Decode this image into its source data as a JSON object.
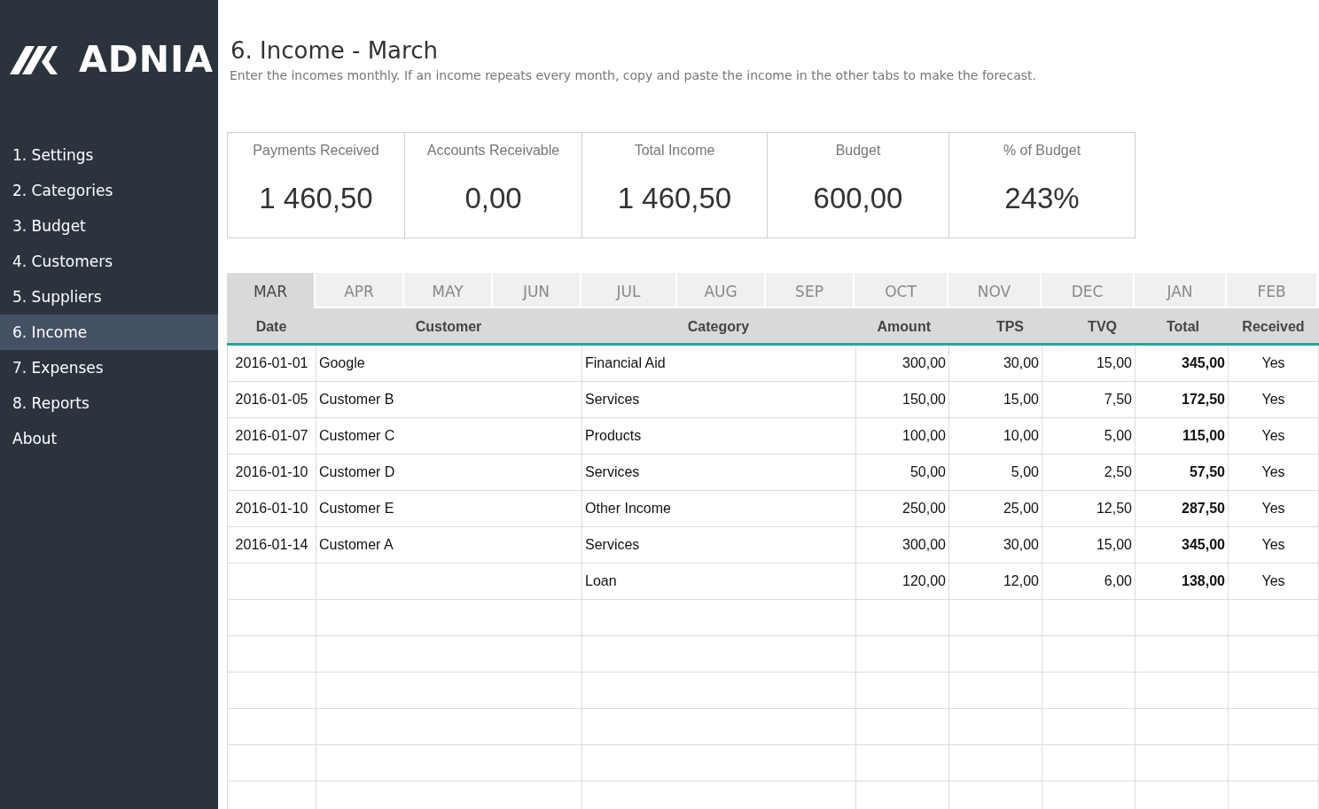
{
  "sidebar": {
    "logo_text": "ADNIA",
    "items": [
      {
        "label": "1. Settings",
        "selected": false
      },
      {
        "label": "2. Categories",
        "selected": false
      },
      {
        "label": "3. Budget",
        "selected": false
      },
      {
        "label": "4. Customers",
        "selected": false
      },
      {
        "label": "5. Suppliers",
        "selected": false
      },
      {
        "label": "6. Income",
        "selected": true
      },
      {
        "label": "7. Expenses",
        "selected": false
      },
      {
        "label": "8. Reports",
        "selected": false
      },
      {
        "label": "About",
        "selected": false
      }
    ]
  },
  "header": {
    "title": "6. Income - March",
    "subtitle": "Enter the incomes monthly. If an income repeats every month, copy and paste the income in the other tabs to make the forecast."
  },
  "summary": [
    {
      "label": "Payments Received",
      "value": "1 460,50"
    },
    {
      "label": "Accounts Receivable",
      "value": "0,00"
    },
    {
      "label": "Total Income",
      "value": "1 460,50"
    },
    {
      "label": "Budget",
      "value": "600,00"
    },
    {
      "label": "% of Budget",
      "value": "243%"
    }
  ],
  "tabs": [
    {
      "label": "MAR",
      "selected": true
    },
    {
      "label": "APR",
      "selected": false
    },
    {
      "label": "MAY",
      "selected": false
    },
    {
      "label": "JUN",
      "selected": false
    },
    {
      "label": "JUL",
      "selected": false
    },
    {
      "label": "AUG",
      "selected": false
    },
    {
      "label": "SEP",
      "selected": false
    },
    {
      "label": "OCT",
      "selected": false
    },
    {
      "label": "NOV",
      "selected": false
    },
    {
      "label": "DEC",
      "selected": false
    },
    {
      "label": "JAN",
      "selected": false
    },
    {
      "label": "FEB",
      "selected": false
    }
  ],
  "table": {
    "columns": [
      "Date",
      "Customer",
      "Category",
      "Amount",
      "TPS",
      "TVQ",
      "Total",
      "Received"
    ],
    "rows": [
      [
        "2016-01-01",
        "Google",
        "Financial Aid",
        "300,00",
        "30,00",
        "15,00",
        "345,00",
        "Yes"
      ],
      [
        "2016-01-05",
        "Customer B",
        "Services",
        "150,00",
        "15,00",
        "7,50",
        "172,50",
        "Yes"
      ],
      [
        "2016-01-07",
        "Customer C",
        "Products",
        "100,00",
        "10,00",
        "5,00",
        "115,00",
        "Yes"
      ],
      [
        "2016-01-10",
        "Customer D",
        "Services",
        "50,00",
        "5,00",
        "2,50",
        "57,50",
        "Yes"
      ],
      [
        "2016-01-10",
        "Customer E",
        "Other Income",
        "250,00",
        "25,00",
        "12,50",
        "287,50",
        "Yes"
      ],
      [
        "2016-01-14",
        "Customer A",
        "Services",
        "300,00",
        "30,00",
        "15,00",
        "345,00",
        "Yes"
      ],
      [
        "",
        "",
        "Loan",
        "120,00",
        "12,00",
        "6,00",
        "138,00",
        "Yes"
      ]
    ]
  }
}
